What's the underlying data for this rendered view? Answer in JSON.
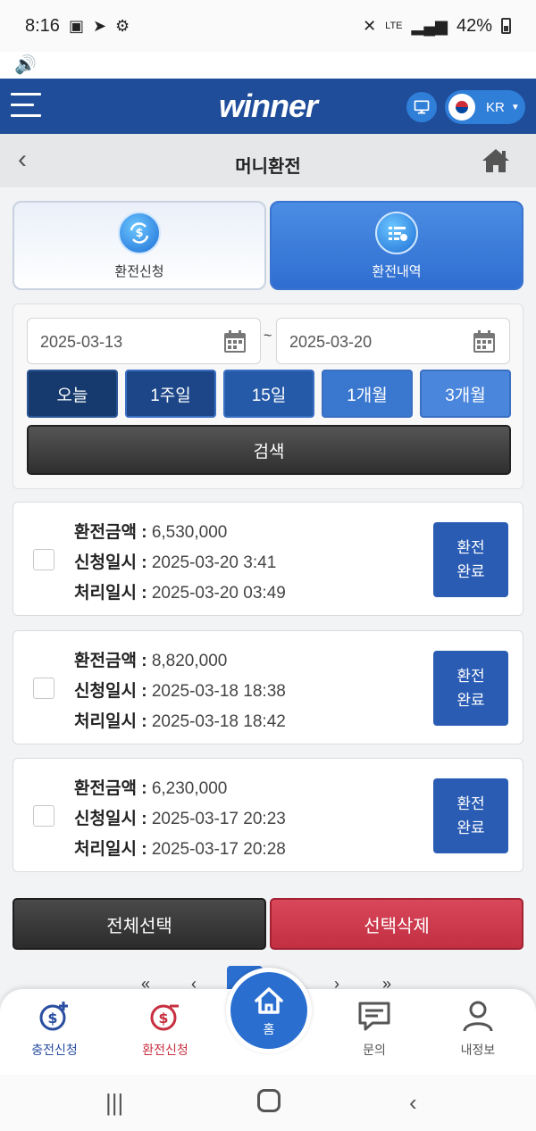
{
  "status_bar": {
    "time": "8:16",
    "network": "LTE",
    "battery": "42%"
  },
  "header": {
    "logo": "winner",
    "language": "KR"
  },
  "page": {
    "title": "머니환전"
  },
  "tabs": [
    {
      "label": "환전신청"
    },
    {
      "label": "환전내역"
    }
  ],
  "filter": {
    "date_from": "2025-03-13",
    "date_to": "2025-03-20",
    "separator": "~",
    "periods": [
      "오늘",
      "1주일",
      "15일",
      "1개월",
      "3개월"
    ],
    "search_label": "검색"
  },
  "records": [
    {
      "amount_label": "환전금액",
      "amount": "6,530,000",
      "request_label": "신청일시",
      "request_time": "2025-03-20 3:41",
      "process_label": "처리일시",
      "process_time": "2025-03-20 03:49",
      "status_line1": "환전",
      "status_line2": "완료"
    },
    {
      "amount_label": "환전금액",
      "amount": "8,820,000",
      "request_label": "신청일시",
      "request_time": "2025-03-18 18:38",
      "process_label": "처리일시",
      "process_time": "2025-03-18 18:42",
      "status_line1": "환전",
      "status_line2": "완료"
    },
    {
      "amount_label": "환전금액",
      "amount": "6,230,000",
      "request_label": "신청일시",
      "request_time": "2025-03-17 20:23",
      "process_label": "처리일시",
      "process_time": "2025-03-17 20:28",
      "status_line1": "환전",
      "status_line2": "완료"
    }
  ],
  "actions": {
    "select_all": "전체선택",
    "delete_selected": "선택삭제"
  },
  "pager": {
    "first": "«",
    "prev": "‹",
    "next": "›",
    "last": "»"
  },
  "bottom_nav": {
    "charge": "충전신청",
    "exchange": "환전신청",
    "home": "홈",
    "inquiry": "문의",
    "profile": "내정보"
  },
  "colors": {
    "header_bg": "#1f4d9a",
    "accent_blue": "#2a6fd0",
    "delete_red": "#c22f43",
    "status_btn": "#2a5cb4"
  }
}
